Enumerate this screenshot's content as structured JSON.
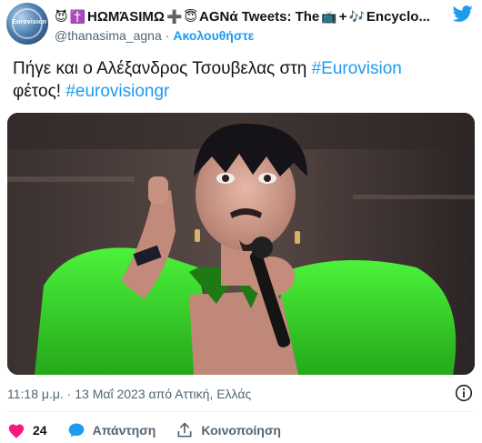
{
  "author": {
    "display_name_parts": [
      "😈",
      "✝️",
      "HΩΜΆSIMΩ",
      "➕",
      "😇",
      "ΑGΝά Tweets: The",
      "📺",
      "+",
      "🎶",
      "Encyclo..."
    ],
    "handle": "@thanasima_agna",
    "separator": "·",
    "follow_label": "Ακολουθήστε",
    "avatar_text": "Eurovision"
  },
  "tweet": {
    "text_before": "Πήγε και ο Αλέξανδρος Τσουβελας στη ",
    "hashtag1": "#Eurovision",
    "text_middle": "φέτος! ",
    "hashtag2": "#eurovisiongr"
  },
  "meta": {
    "timestamp": "11:18 μ.μ. · 13 Μαΐ 2023 από Αττική, Ελλάς"
  },
  "actions": {
    "like_count": "24",
    "reply_label": "Απάντηση",
    "share_label": "Κοινοποίηση"
  },
  "colors": {
    "accent": "#1d9bf0",
    "like": "#f91880",
    "muted": "#536471",
    "jacket": "#3ddc2a"
  }
}
